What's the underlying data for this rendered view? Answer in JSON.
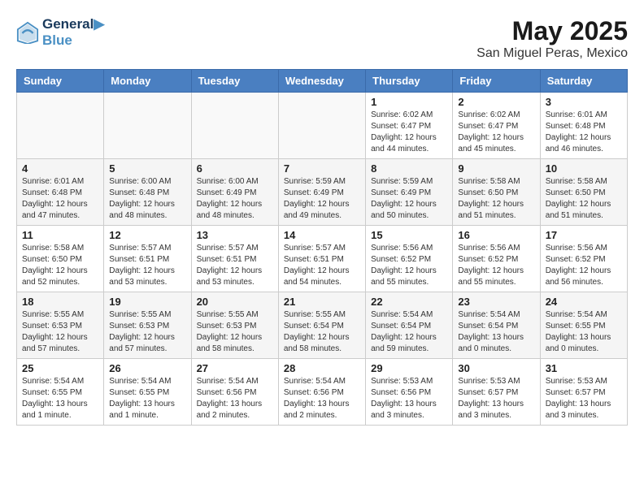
{
  "header": {
    "logo_line1": "General",
    "logo_line2": "Blue",
    "month": "May 2025",
    "location": "San Miguel Peras, Mexico"
  },
  "weekdays": [
    "Sunday",
    "Monday",
    "Tuesday",
    "Wednesday",
    "Thursday",
    "Friday",
    "Saturday"
  ],
  "weeks": [
    [
      {
        "day": "",
        "info": ""
      },
      {
        "day": "",
        "info": ""
      },
      {
        "day": "",
        "info": ""
      },
      {
        "day": "",
        "info": ""
      },
      {
        "day": "1",
        "info": "Sunrise: 6:02 AM\nSunset: 6:47 PM\nDaylight: 12 hours\nand 44 minutes."
      },
      {
        "day": "2",
        "info": "Sunrise: 6:02 AM\nSunset: 6:47 PM\nDaylight: 12 hours\nand 45 minutes."
      },
      {
        "day": "3",
        "info": "Sunrise: 6:01 AM\nSunset: 6:48 PM\nDaylight: 12 hours\nand 46 minutes."
      }
    ],
    [
      {
        "day": "4",
        "info": "Sunrise: 6:01 AM\nSunset: 6:48 PM\nDaylight: 12 hours\nand 47 minutes."
      },
      {
        "day": "5",
        "info": "Sunrise: 6:00 AM\nSunset: 6:48 PM\nDaylight: 12 hours\nand 48 minutes."
      },
      {
        "day": "6",
        "info": "Sunrise: 6:00 AM\nSunset: 6:49 PM\nDaylight: 12 hours\nand 48 minutes."
      },
      {
        "day": "7",
        "info": "Sunrise: 5:59 AM\nSunset: 6:49 PM\nDaylight: 12 hours\nand 49 minutes."
      },
      {
        "day": "8",
        "info": "Sunrise: 5:59 AM\nSunset: 6:49 PM\nDaylight: 12 hours\nand 50 minutes."
      },
      {
        "day": "9",
        "info": "Sunrise: 5:58 AM\nSunset: 6:50 PM\nDaylight: 12 hours\nand 51 minutes."
      },
      {
        "day": "10",
        "info": "Sunrise: 5:58 AM\nSunset: 6:50 PM\nDaylight: 12 hours\nand 51 minutes."
      }
    ],
    [
      {
        "day": "11",
        "info": "Sunrise: 5:58 AM\nSunset: 6:50 PM\nDaylight: 12 hours\nand 52 minutes."
      },
      {
        "day": "12",
        "info": "Sunrise: 5:57 AM\nSunset: 6:51 PM\nDaylight: 12 hours\nand 53 minutes."
      },
      {
        "day": "13",
        "info": "Sunrise: 5:57 AM\nSunset: 6:51 PM\nDaylight: 12 hours\nand 53 minutes."
      },
      {
        "day": "14",
        "info": "Sunrise: 5:57 AM\nSunset: 6:51 PM\nDaylight: 12 hours\nand 54 minutes."
      },
      {
        "day": "15",
        "info": "Sunrise: 5:56 AM\nSunset: 6:52 PM\nDaylight: 12 hours\nand 55 minutes."
      },
      {
        "day": "16",
        "info": "Sunrise: 5:56 AM\nSunset: 6:52 PM\nDaylight: 12 hours\nand 55 minutes."
      },
      {
        "day": "17",
        "info": "Sunrise: 5:56 AM\nSunset: 6:52 PM\nDaylight: 12 hours\nand 56 minutes."
      }
    ],
    [
      {
        "day": "18",
        "info": "Sunrise: 5:55 AM\nSunset: 6:53 PM\nDaylight: 12 hours\nand 57 minutes."
      },
      {
        "day": "19",
        "info": "Sunrise: 5:55 AM\nSunset: 6:53 PM\nDaylight: 12 hours\nand 57 minutes."
      },
      {
        "day": "20",
        "info": "Sunrise: 5:55 AM\nSunset: 6:53 PM\nDaylight: 12 hours\nand 58 minutes."
      },
      {
        "day": "21",
        "info": "Sunrise: 5:55 AM\nSunset: 6:54 PM\nDaylight: 12 hours\nand 58 minutes."
      },
      {
        "day": "22",
        "info": "Sunrise: 5:54 AM\nSunset: 6:54 PM\nDaylight: 12 hours\nand 59 minutes."
      },
      {
        "day": "23",
        "info": "Sunrise: 5:54 AM\nSunset: 6:54 PM\nDaylight: 13 hours\nand 0 minutes."
      },
      {
        "day": "24",
        "info": "Sunrise: 5:54 AM\nSunset: 6:55 PM\nDaylight: 13 hours\nand 0 minutes."
      }
    ],
    [
      {
        "day": "25",
        "info": "Sunrise: 5:54 AM\nSunset: 6:55 PM\nDaylight: 13 hours\nand 1 minute."
      },
      {
        "day": "26",
        "info": "Sunrise: 5:54 AM\nSunset: 6:55 PM\nDaylight: 13 hours\nand 1 minute."
      },
      {
        "day": "27",
        "info": "Sunrise: 5:54 AM\nSunset: 6:56 PM\nDaylight: 13 hours\nand 2 minutes."
      },
      {
        "day": "28",
        "info": "Sunrise: 5:54 AM\nSunset: 6:56 PM\nDaylight: 13 hours\nand 2 minutes."
      },
      {
        "day": "29",
        "info": "Sunrise: 5:53 AM\nSunset: 6:56 PM\nDaylight: 13 hours\nand 3 minutes."
      },
      {
        "day": "30",
        "info": "Sunrise: 5:53 AM\nSunset: 6:57 PM\nDaylight: 13 hours\nand 3 minutes."
      },
      {
        "day": "31",
        "info": "Sunrise: 5:53 AM\nSunset: 6:57 PM\nDaylight: 13 hours\nand 3 minutes."
      }
    ]
  ]
}
